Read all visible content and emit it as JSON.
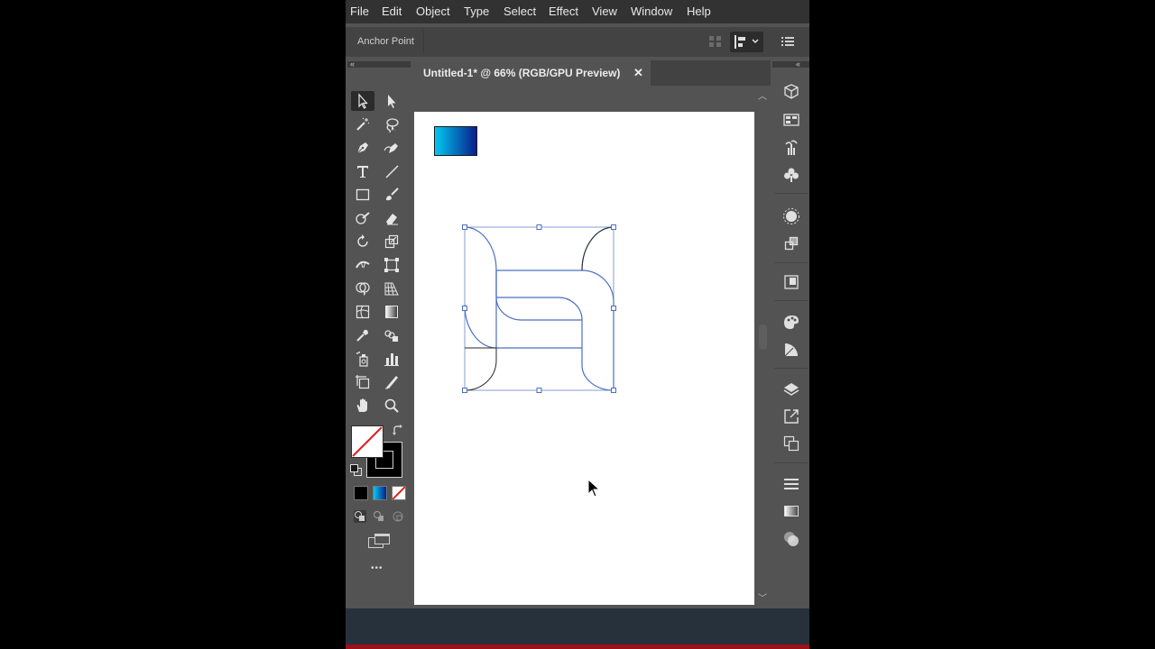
{
  "menu": [
    "File",
    "Edit",
    "Object",
    "Type",
    "Select",
    "Effect",
    "View",
    "Window",
    "Help"
  ],
  "control_bar": {
    "label": "Anchor Point"
  },
  "document_tab": {
    "title": "Untitled-1* @ 66% (RGB/GPU Preview)",
    "close_glyph": "✕"
  },
  "toolbar": {
    "tools": [
      "selection-tool",
      "direct-selection-tool",
      "magic-wand-tool",
      "lasso-tool",
      "pen-tool",
      "curvature-tool",
      "type-tool",
      "line-segment-tool",
      "rectangle-tool",
      "paintbrush-tool",
      "shaper-tool",
      "eraser-tool",
      "rotate-tool",
      "scale-tool",
      "width-tool",
      "free-transform-tool",
      "shape-builder-tool",
      "perspective-grid-tool",
      "mesh-tool",
      "gradient-tool",
      "eyedropper-tool",
      "blend-tool",
      "symbol-sprayer-tool",
      "column-graph-tool",
      "artboard-tool",
      "slice-tool",
      "hand-tool",
      "zoom-tool"
    ],
    "active_tool": "selection-tool",
    "more_glyph": "•••"
  },
  "colors": {
    "fill": "none",
    "stroke": "#000000",
    "gradient_swatch_start": "#00c8f0",
    "gradient_swatch_end": "#0a1e8c",
    "selection_color": "#4a6fc0",
    "ui_background": "#535353",
    "menubar_background": "#323232",
    "artboard": "#ffffff"
  },
  "right_panel": {
    "icons": [
      "libraries-icon",
      "swatch-libraries-icon",
      "brushes-icon",
      "symbols-icon",
      "appearance-icon",
      "transform-icon",
      "export-icon",
      "color-icon",
      "color-guide-icon",
      "layers-icon",
      "asset-export-icon",
      "artboards-icon",
      "stroke-icon",
      "gradient-icon",
      "transparency-icon"
    ]
  }
}
